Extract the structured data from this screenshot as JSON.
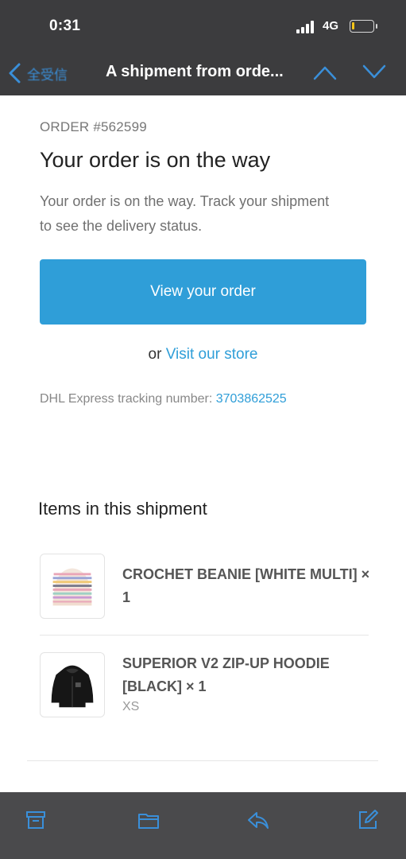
{
  "status_bar": {
    "time": "0:31",
    "network": "4G"
  },
  "nav": {
    "back_label": "全受信",
    "title": "A shipment from orde..."
  },
  "email": {
    "order_number": "ORDER #562599",
    "headline": "Your order is on the way",
    "description": "Your order is on the way. Track your shipment to see the delivery status.",
    "cta_label": "View your order",
    "alt_prefix": "or ",
    "alt_link": "Visit our store",
    "tracking_label": "DHL Express tracking number: ",
    "tracking_number": "3703862525",
    "items_title": "Items in this shipment",
    "items": [
      {
        "name": "CROCHET BEANIE [WHITE MULTI] × 1",
        "variant": "",
        "thumb": "beanie-image"
      },
      {
        "name": "SUPERIOR V2 ZIP-UP HOODIE [BLACK] × 1",
        "variant": "XS",
        "thumb": "hoodie-image"
      }
    ]
  },
  "toolbar": {
    "icons": [
      "archive-icon",
      "folder-icon",
      "reply-icon",
      "compose-icon"
    ]
  },
  "colors": {
    "accent": "#2f9ed8",
    "header_bg": "#3c3c3e",
    "toolbar_bg": "#4a4a4c",
    "icon_blue": "#3a8fd9"
  }
}
